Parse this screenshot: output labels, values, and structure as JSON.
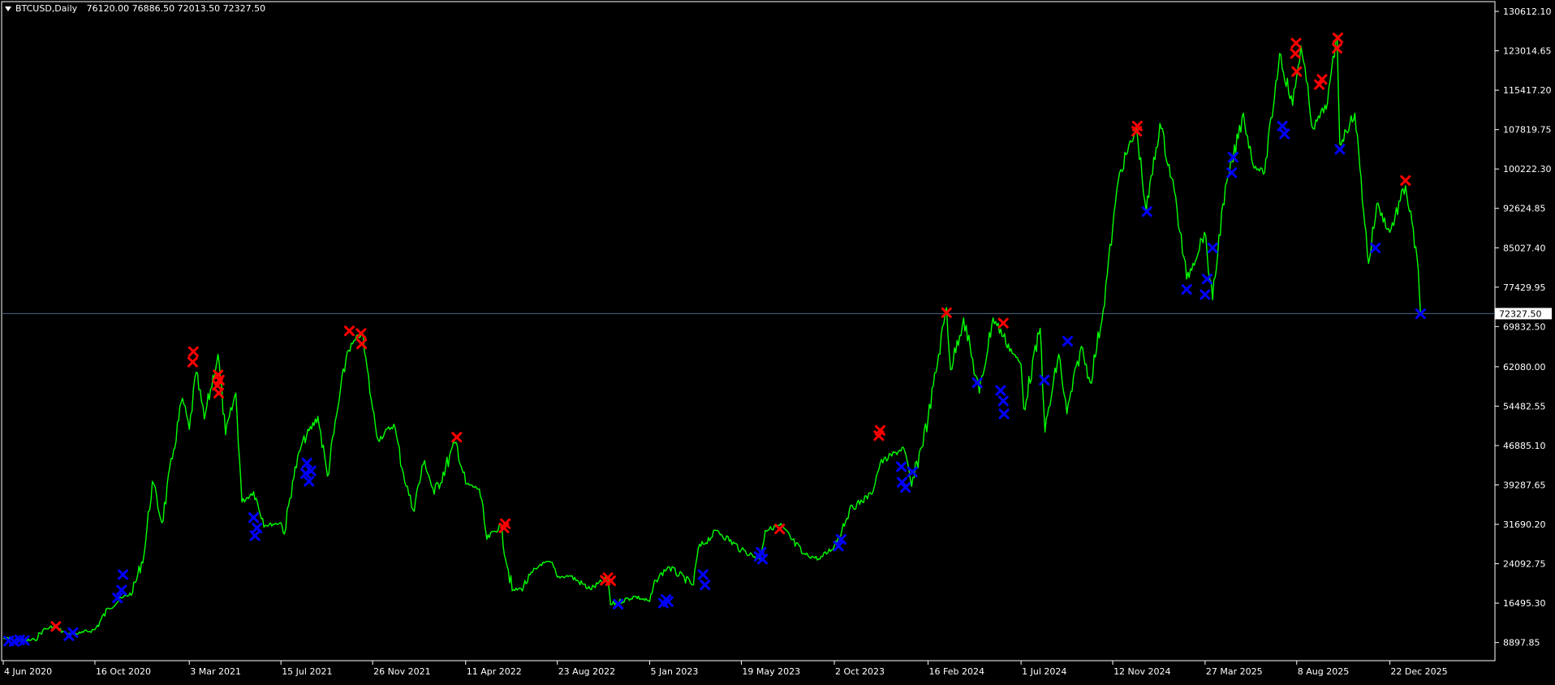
{
  "header": {
    "symbol_label": "BTCUSD,Daily",
    "ohlc": "76120.00 76886.50 72013.50 72327.50"
  },
  "colors": {
    "background": "#000000",
    "price_line": "#00ff00",
    "axis": "#ffffff",
    "sell_marker": "#ff0000",
    "buy_marker": "#0000ff",
    "current_price_line": "#4a6a8a"
  },
  "chart_data": {
    "type": "line",
    "symbol": "BTCUSD",
    "timeframe": "Daily",
    "open": 76120.0,
    "high": 76886.5,
    "low": 72013.5,
    "close": 72327.5,
    "current_price": 72327.5,
    "current_price_label": "72327.50",
    "ylim": [
      5400,
      132500
    ],
    "y_ticks": [
      {
        "value": 130612.1,
        "label": "130612.10"
      },
      {
        "value": 123014.65,
        "label": "123014.65"
      },
      {
        "value": 115417.2,
        "label": "115417.20"
      },
      {
        "value": 107819.75,
        "label": "107819.75"
      },
      {
        "value": 100222.3,
        "label": "100222.30"
      },
      {
        "value": 92624.85,
        "label": "92624.85"
      },
      {
        "value": 85027.4,
        "label": "85027.40"
      },
      {
        "value": 77429.95,
        "label": "77429.95"
      },
      {
        "value": 69832.5,
        "label": "69832.50"
      },
      {
        "value": 62080.0,
        "label": "62080.00"
      },
      {
        "value": 54482.55,
        "label": "54482.55"
      },
      {
        "value": 46885.1,
        "label": "46885.10"
      },
      {
        "value": 39287.65,
        "label": "39287.65"
      },
      {
        "value": 31690.2,
        "label": "31690.20"
      },
      {
        "value": 24092.75,
        "label": "24092.75"
      },
      {
        "value": 16495.3,
        "label": "16495.30"
      },
      {
        "value": 8897.85,
        "label": "8897.85"
      }
    ],
    "x_ticks": [
      {
        "date": "2020-06-04",
        "label": "4 Jun 2020"
      },
      {
        "date": "2020-10-16",
        "label": "16 Oct 2020"
      },
      {
        "date": "2021-03-03",
        "label": "3 Mar 2021"
      },
      {
        "date": "2021-07-15",
        "label": "15 Jul 2021"
      },
      {
        "date": "2021-11-26",
        "label": "26 Nov 2021"
      },
      {
        "date": "2022-04-11",
        "label": "11 Apr 2022"
      },
      {
        "date": "2022-08-23",
        "label": "23 Aug 2022"
      },
      {
        "date": "2023-01-05",
        "label": "5 Jan 2023"
      },
      {
        "date": "2023-05-19",
        "label": "19 May 2023"
      },
      {
        "date": "2023-10-02",
        "label": "2 Oct 2023"
      },
      {
        "date": "2024-02-16",
        "label": "16 Feb 2024"
      },
      {
        "date": "2024-07-01",
        "label": "1 Jul 2024"
      },
      {
        "date": "2024-11-12",
        "label": "12 Nov 2024"
      },
      {
        "date": "2025-03-27",
        "label": "27 Mar 2025"
      },
      {
        "date": "2025-08-08",
        "label": "8 Aug 2025"
      },
      {
        "date": "2025-12-22",
        "label": "22 Dec 2025"
      }
    ],
    "x_range": [
      "2020-06-04",
      "2026-05-20"
    ],
    "series": [
      {
        "points": [
          [
            "2020-06-04",
            9700
          ],
          [
            "2020-07-01",
            9200
          ],
          [
            "2020-07-20",
            9400
          ],
          [
            "2020-08-01",
            11300
          ],
          [
            "2020-08-17",
            12000
          ],
          [
            "2020-09-05",
            10500
          ],
          [
            "2020-09-25",
            10700
          ],
          [
            "2020-10-16",
            11400
          ],
          [
            "2020-11-05",
            15500
          ],
          [
            "2020-11-25",
            17500
          ],
          [
            "2020-12-10",
            18500
          ],
          [
            "2020-12-27",
            26000
          ],
          [
            "2021-01-08",
            40000
          ],
          [
            "2021-01-22",
            32000
          ],
          [
            "2021-02-08",
            46000
          ],
          [
            "2021-02-21",
            56000
          ],
          [
            "2021-03-03",
            50000
          ],
          [
            "2021-03-13",
            61000
          ],
          [
            "2021-03-25",
            52000
          ],
          [
            "2021-04-14",
            64500
          ],
          [
            "2021-04-25",
            49000
          ],
          [
            "2021-05-10",
            57000
          ],
          [
            "2021-05-19",
            36000
          ],
          [
            "2021-06-05",
            38000
          ],
          [
            "2021-06-22",
            31500
          ],
          [
            "2021-07-15",
            32000
          ],
          [
            "2021-07-20",
            29800
          ],
          [
            "2021-08-01",
            40000
          ],
          [
            "2021-08-14",
            47000
          ],
          [
            "2021-09-07",
            52500
          ],
          [
            "2021-09-21",
            41000
          ],
          [
            "2021-10-06",
            54000
          ],
          [
            "2021-10-20",
            65000
          ],
          [
            "2021-11-10",
            68700
          ],
          [
            "2021-11-26",
            54000
          ],
          [
            "2021-12-04",
            48000
          ],
          [
            "2021-12-27",
            51000
          ],
          [
            "2022-01-10",
            41500
          ],
          [
            "2022-01-24",
            34500
          ],
          [
            "2022-02-10",
            44000
          ],
          [
            "2022-02-24",
            37500
          ],
          [
            "2022-03-28",
            47500
          ],
          [
            "2022-04-11",
            39500
          ],
          [
            "2022-05-01",
            38500
          ],
          [
            "2022-05-12",
            28800
          ],
          [
            "2022-06-01",
            31500
          ],
          [
            "2022-06-18",
            18900
          ],
          [
            "2022-07-01",
            19300
          ],
          [
            "2022-07-29",
            24000
          ],
          [
            "2022-08-14",
            24400
          ],
          [
            "2022-08-23",
            21500
          ],
          [
            "2022-09-10",
            21800
          ],
          [
            "2022-10-10",
            19200
          ],
          [
            "2022-11-05",
            21300
          ],
          [
            "2022-11-09",
            16200
          ],
          [
            "2022-12-14",
            17800
          ],
          [
            "2023-01-05",
            16800
          ],
          [
            "2023-01-14",
            20900
          ],
          [
            "2023-02-01",
            23500
          ],
          [
            "2023-03-10",
            20000
          ],
          [
            "2023-03-17",
            27000
          ],
          [
            "2023-04-14",
            30500
          ],
          [
            "2023-05-19",
            26800
          ],
          [
            "2023-06-15",
            25000
          ],
          [
            "2023-06-23",
            30500
          ],
          [
            "2023-07-14",
            31500
          ],
          [
            "2023-08-17",
            26000
          ],
          [
            "2023-09-11",
            25000
          ],
          [
            "2023-10-02",
            27500
          ],
          [
            "2023-10-24",
            34500
          ],
          [
            "2023-11-25",
            37500
          ],
          [
            "2023-12-08",
            43500
          ],
          [
            "2024-01-11",
            46500
          ],
          [
            "2024-01-23",
            39000
          ],
          [
            "2024-02-16",
            52000
          ],
          [
            "2024-03-14",
            73500
          ],
          [
            "2024-03-20",
            61500
          ],
          [
            "2024-04-08",
            71500
          ],
          [
            "2024-05-01",
            57000
          ],
          [
            "2024-05-21",
            71500
          ],
          [
            "2024-06-20",
            64500
          ],
          [
            "2024-07-01",
            62500
          ],
          [
            "2024-07-05",
            54000
          ],
          [
            "2024-07-29",
            69500
          ],
          [
            "2024-08-05",
            49500
          ],
          [
            "2024-08-25",
            64500
          ],
          [
            "2024-09-06",
            53000
          ],
          [
            "2024-09-27",
            66000
          ],
          [
            "2024-10-10",
            59000
          ],
          [
            "2024-10-29",
            73000
          ],
          [
            "2024-11-12",
            89000
          ],
          [
            "2024-11-22",
            99500
          ],
          [
            "2024-12-17",
            108000
          ],
          [
            "2024-12-31",
            92000
          ],
          [
            "2025-01-20",
            109000
          ],
          [
            "2025-02-10",
            96000
          ],
          [
            "2025-02-28",
            79000
          ],
          [
            "2025-03-26",
            88000
          ],
          [
            "2025-04-07",
            75000
          ],
          [
            "2025-04-22",
            93500
          ],
          [
            "2025-05-22",
            111000
          ],
          [
            "2025-06-05",
            101000
          ],
          [
            "2025-06-22",
            99500
          ],
          [
            "2025-07-14",
            122500
          ],
          [
            "2025-08-02",
            112500
          ],
          [
            "2025-08-14",
            124000
          ],
          [
            "2025-09-01",
            108000
          ],
          [
            "2025-09-22",
            113000
          ],
          [
            "2025-10-06",
            126000
          ],
          [
            "2025-10-10",
            105000
          ],
          [
            "2025-11-01",
            111000
          ],
          [
            "2025-11-21",
            82000
          ],
          [
            "2025-12-03",
            93500
          ],
          [
            "2025-12-22",
            88000
          ],
          [
            "2026-01-14",
            97000
          ],
          [
            "2026-01-31",
            83000
          ],
          [
            "2026-02-05",
            72300
          ]
        ]
      }
    ],
    "sell_markers": [
      [
        "2020-08-20",
        12000
      ],
      [
        "2021-03-08",
        63000
      ],
      [
        "2021-03-09",
        65000
      ],
      [
        "2021-04-13",
        58500
      ],
      [
        "2021-04-14",
        60500
      ],
      [
        "2021-04-15",
        57000
      ],
      [
        "2021-04-16",
        59500
      ],
      [
        "2021-10-23",
        69000
      ],
      [
        "2021-11-09",
        68500
      ],
      [
        "2021-11-10",
        66500
      ],
      [
        "2022-03-29",
        48500
      ],
      [
        "2022-06-06",
        31000
      ],
      [
        "2022-06-08",
        31800
      ],
      [
        "2022-11-01",
        20900
      ],
      [
        "2022-11-05",
        21400
      ],
      [
        "2022-11-09",
        20800
      ],
      [
        "2023-07-14",
        30800
      ],
      [
        "2023-12-06",
        48800
      ],
      [
        "2023-12-08",
        49800
      ],
      [
        "2024-03-14",
        72500
      ],
      [
        "2024-06-05",
        70500
      ],
      [
        "2024-12-17",
        107500
      ],
      [
        "2024-12-18",
        108500
      ],
      [
        "2025-08-06",
        122500
      ],
      [
        "2025-08-07",
        124500
      ],
      [
        "2025-08-08",
        119000
      ],
      [
        "2025-09-10",
        116500
      ],
      [
        "2025-09-14",
        117500
      ],
      [
        "2025-10-06",
        123500
      ],
      [
        "2025-10-07",
        125500
      ],
      [
        "2026-01-14",
        98000
      ]
    ],
    "buy_markers": [
      [
        "2020-06-12",
        9200
      ],
      [
        "2020-06-20",
        9100
      ],
      [
        "2020-06-28",
        9400
      ],
      [
        "2020-07-05",
        9300
      ],
      [
        "2020-09-08",
        10200
      ],
      [
        "2020-09-14",
        10800
      ],
      [
        "2020-11-18",
        17500
      ],
      [
        "2020-11-24",
        19000
      ],
      [
        "2020-11-26",
        22000
      ],
      [
        "2021-06-05",
        33000
      ],
      [
        "2021-06-07",
        29500
      ],
      [
        "2021-06-10",
        31000
      ],
      [
        "2021-08-20",
        41500
      ],
      [
        "2021-08-22",
        43500
      ],
      [
        "2021-08-25",
        40000
      ],
      [
        "2021-08-28",
        42000
      ],
      [
        "2022-11-20",
        16300
      ],
      [
        "2023-01-25",
        16500
      ],
      [
        "2023-01-29",
        17200
      ],
      [
        "2023-02-01",
        16800
      ],
      [
        "2023-03-24",
        22000
      ],
      [
        "2023-03-27",
        20000
      ],
      [
        "2023-06-14",
        25500
      ],
      [
        "2023-06-17",
        26300
      ],
      [
        "2023-06-19",
        25000
      ],
      [
        "2023-10-08",
        27500
      ],
      [
        "2023-10-12",
        28800
      ],
      [
        "2024-01-08",
        42800
      ],
      [
        "2024-01-09",
        39800
      ],
      [
        "2024-01-14",
        38800
      ],
      [
        "2024-01-24",
        41800
      ],
      [
        "2024-04-28",
        59000
      ],
      [
        "2024-06-01",
        57500
      ],
      [
        "2024-06-05",
        55500
      ],
      [
        "2024-06-06",
        53000
      ],
      [
        "2024-08-04",
        59500
      ],
      [
        "2024-09-07",
        67000
      ],
      [
        "2025-01-01",
        92000
      ],
      [
        "2025-02-28",
        77000
      ],
      [
        "2025-03-27",
        76000
      ],
      [
        "2025-03-30",
        79000
      ],
      [
        "2025-04-07",
        85000
      ],
      [
        "2025-05-05",
        99500
      ],
      [
        "2025-05-07",
        102500
      ],
      [
        "2025-07-18",
        108500
      ],
      [
        "2025-07-21",
        107000
      ],
      [
        "2025-10-10",
        104000
      ],
      [
        "2025-12-01",
        85000
      ],
      [
        "2026-02-05",
        72300
      ]
    ]
  }
}
